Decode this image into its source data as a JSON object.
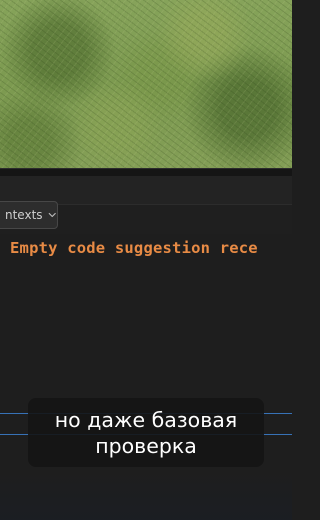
{
  "video_frame": {
    "background": "grass-photo",
    "colors": {
      "grass": "#7c9a50",
      "ide_bg": "#1e1e1e",
      "error_text": "#e88b45",
      "rule_line": "#3a7bc8"
    }
  },
  "ide": {
    "context_dropdown": {
      "label": "ntexts",
      "icon": "chevron-down-icon"
    },
    "editor": {
      "error_message": "Empty code suggestion rece"
    }
  },
  "caption": {
    "line1": "но даже базовая",
    "line2": "проверка"
  }
}
